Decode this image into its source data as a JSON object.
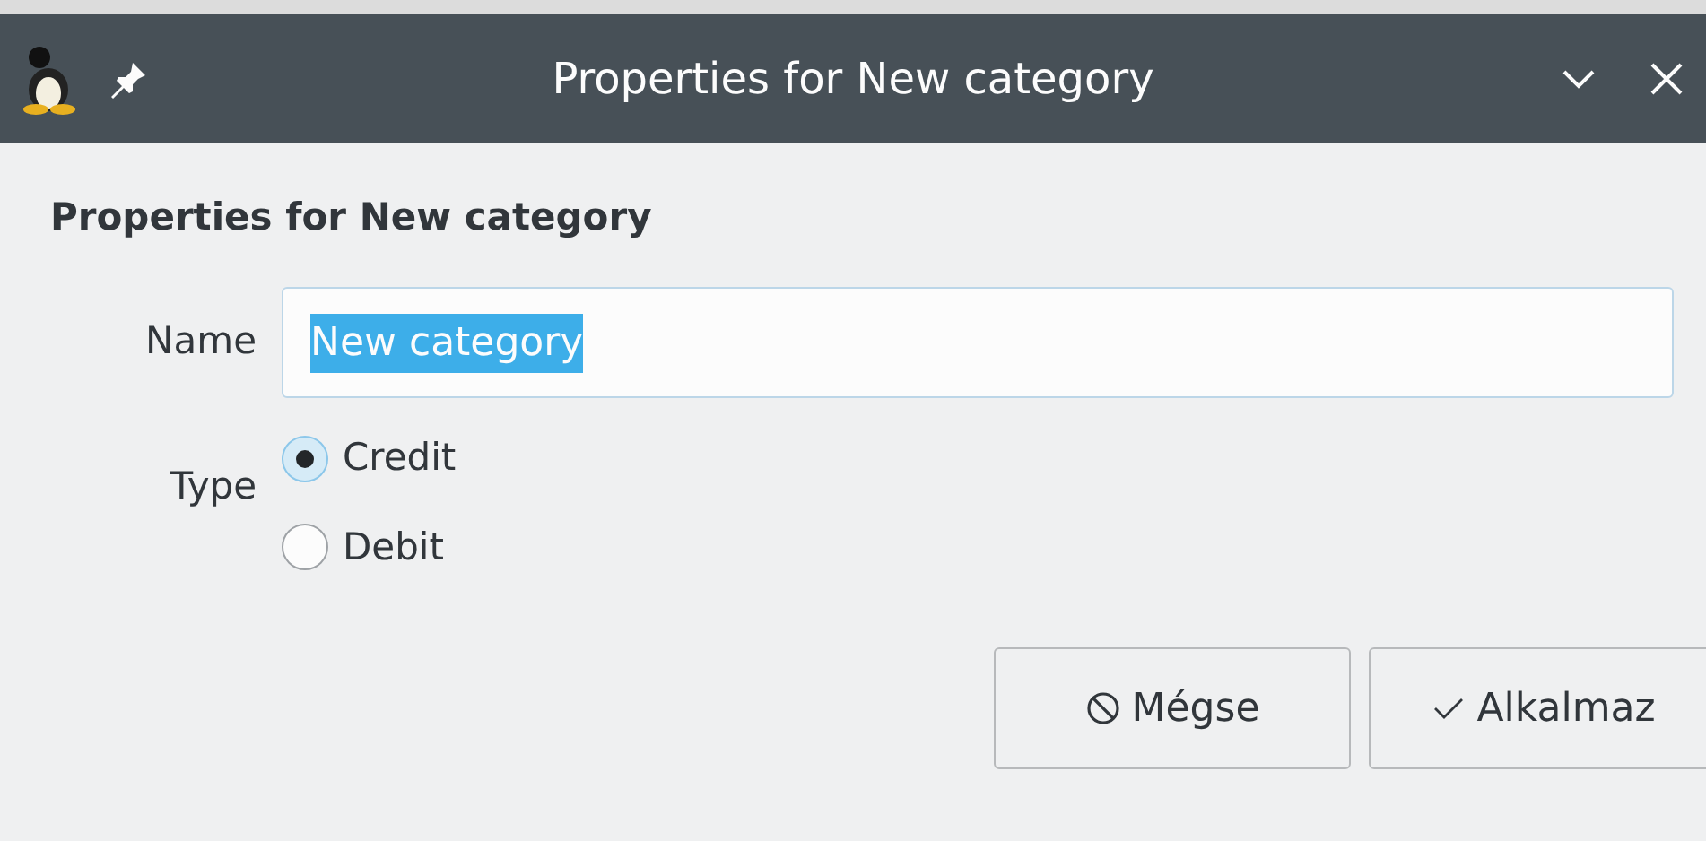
{
  "window": {
    "title": "Properties for New category"
  },
  "heading": "Properties for New category",
  "name_field": {
    "label": "Name",
    "value": "New category",
    "text_selected": true
  },
  "type_group": {
    "label": "Type",
    "options": [
      {
        "label": "Credit",
        "selected": true
      },
      {
        "label": "Debit",
        "selected": false
      }
    ]
  },
  "buttons": [
    {
      "label": "Mégse",
      "kind": "cancel"
    },
    {
      "label": "Alkalmaz",
      "kind": "apply"
    }
  ]
}
